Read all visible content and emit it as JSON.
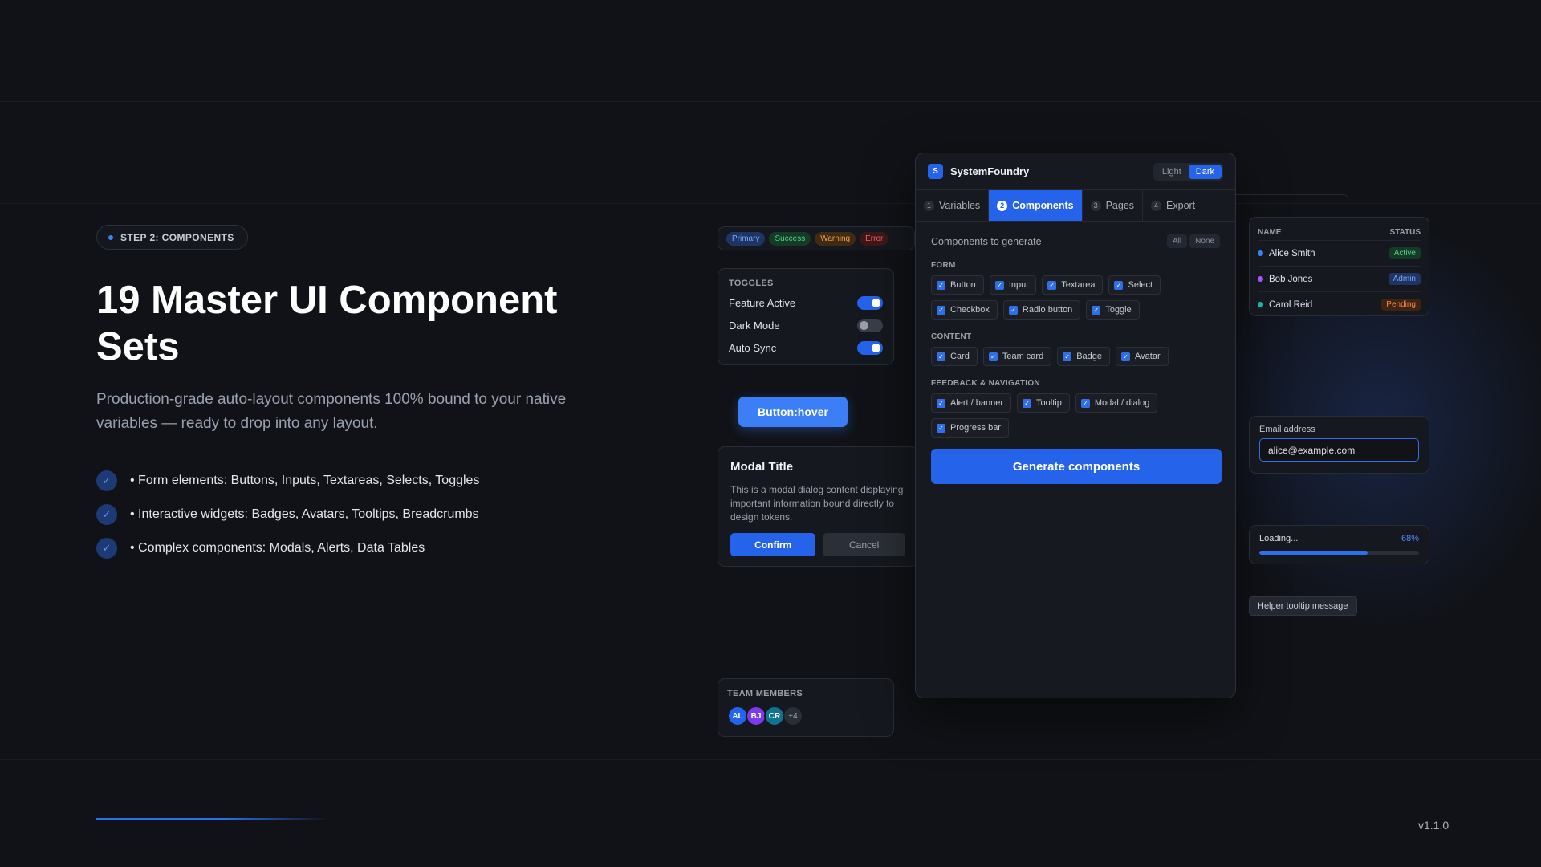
{
  "hero": {
    "step": "STEP 2: COMPONENTS",
    "title": "19 Master UI Component Sets",
    "subtitle": "Production-grade auto-layout components 100% bound to your native variables — ready to drop into any layout.",
    "bullets": [
      "• Form elements: Buttons, Inputs, Textareas, Selects, Toggles",
      "• Interactive widgets: Badges, Avatars, Tooltips, Breadcrumbs",
      "• Complex components: Modals, Alerts, Data Tables"
    ]
  },
  "version": "v1.1.0",
  "badges": [
    "Primary",
    "Success",
    "Warning",
    "Error"
  ],
  "toggles": {
    "title": "TOGGLES",
    "items": [
      {
        "label": "Feature Active",
        "state": "on"
      },
      {
        "label": "Dark Mode",
        "state": "off"
      },
      {
        "label": "Auto Sync",
        "state": "on"
      }
    ]
  },
  "hover_button": "Button:hover",
  "modal": {
    "title": "Modal Title",
    "body": "This is a modal dialog content displaying important information bound directly to design tokens.",
    "confirm": "Confirm",
    "cancel": "Cancel"
  },
  "team": {
    "title": "TEAM MEMBERS",
    "avatars": [
      {
        "initials": "AL",
        "color": "#2563eb"
      },
      {
        "initials": "BJ",
        "color": "#7c3aed"
      },
      {
        "initials": "CR",
        "color": "#0e7490"
      },
      {
        "initials": "+4",
        "color": "#2a2e36"
      }
    ]
  },
  "panel": {
    "brand_logo": "S",
    "brand": "SystemFoundry",
    "theme": {
      "light": "Light",
      "dark": "Dark",
      "selected": "Dark"
    },
    "tabs": [
      {
        "num": "1",
        "label": "Variables"
      },
      {
        "num": "2",
        "label": "Components"
      },
      {
        "num": "3",
        "label": "Pages"
      },
      {
        "num": "4",
        "label": "Export"
      }
    ],
    "active_tab": "Components",
    "gen_label": "Components to generate",
    "select_all": "All",
    "select_none": "None",
    "groups": [
      {
        "title": "FORM",
        "items": [
          "Button",
          "Input",
          "Textarea",
          "Select",
          "Checkbox",
          "Radio button",
          "Toggle"
        ]
      },
      {
        "title": "CONTENT",
        "items": [
          "Card",
          "Team card",
          "Badge",
          "Avatar"
        ]
      },
      {
        "title": "FEEDBACK & NAVIGATION",
        "items": [
          "Alert / banner",
          "Tooltip",
          "Modal / dialog",
          "Progress bar"
        ]
      }
    ],
    "generate_button": "Generate components"
  },
  "table": {
    "col_name": "NAME",
    "col_status": "STATUS",
    "rows": [
      {
        "name": "Alice Smith",
        "status": "Active",
        "dot": "#3b82f6"
      },
      {
        "name": "Bob Jones",
        "status": "Admin",
        "dot": "#a855f7"
      },
      {
        "name": "Carol Reid",
        "status": "Pending",
        "dot": "#14b8a6"
      }
    ]
  },
  "email": {
    "label": "Email address",
    "value": "alice@example.com"
  },
  "loading": {
    "label": "Loading...",
    "percent_text": "68%",
    "progress": 0.68
  },
  "tooltip": "Helper tooltip message",
  "colors": {
    "accent": "#2563eb",
    "background": "#101217"
  }
}
